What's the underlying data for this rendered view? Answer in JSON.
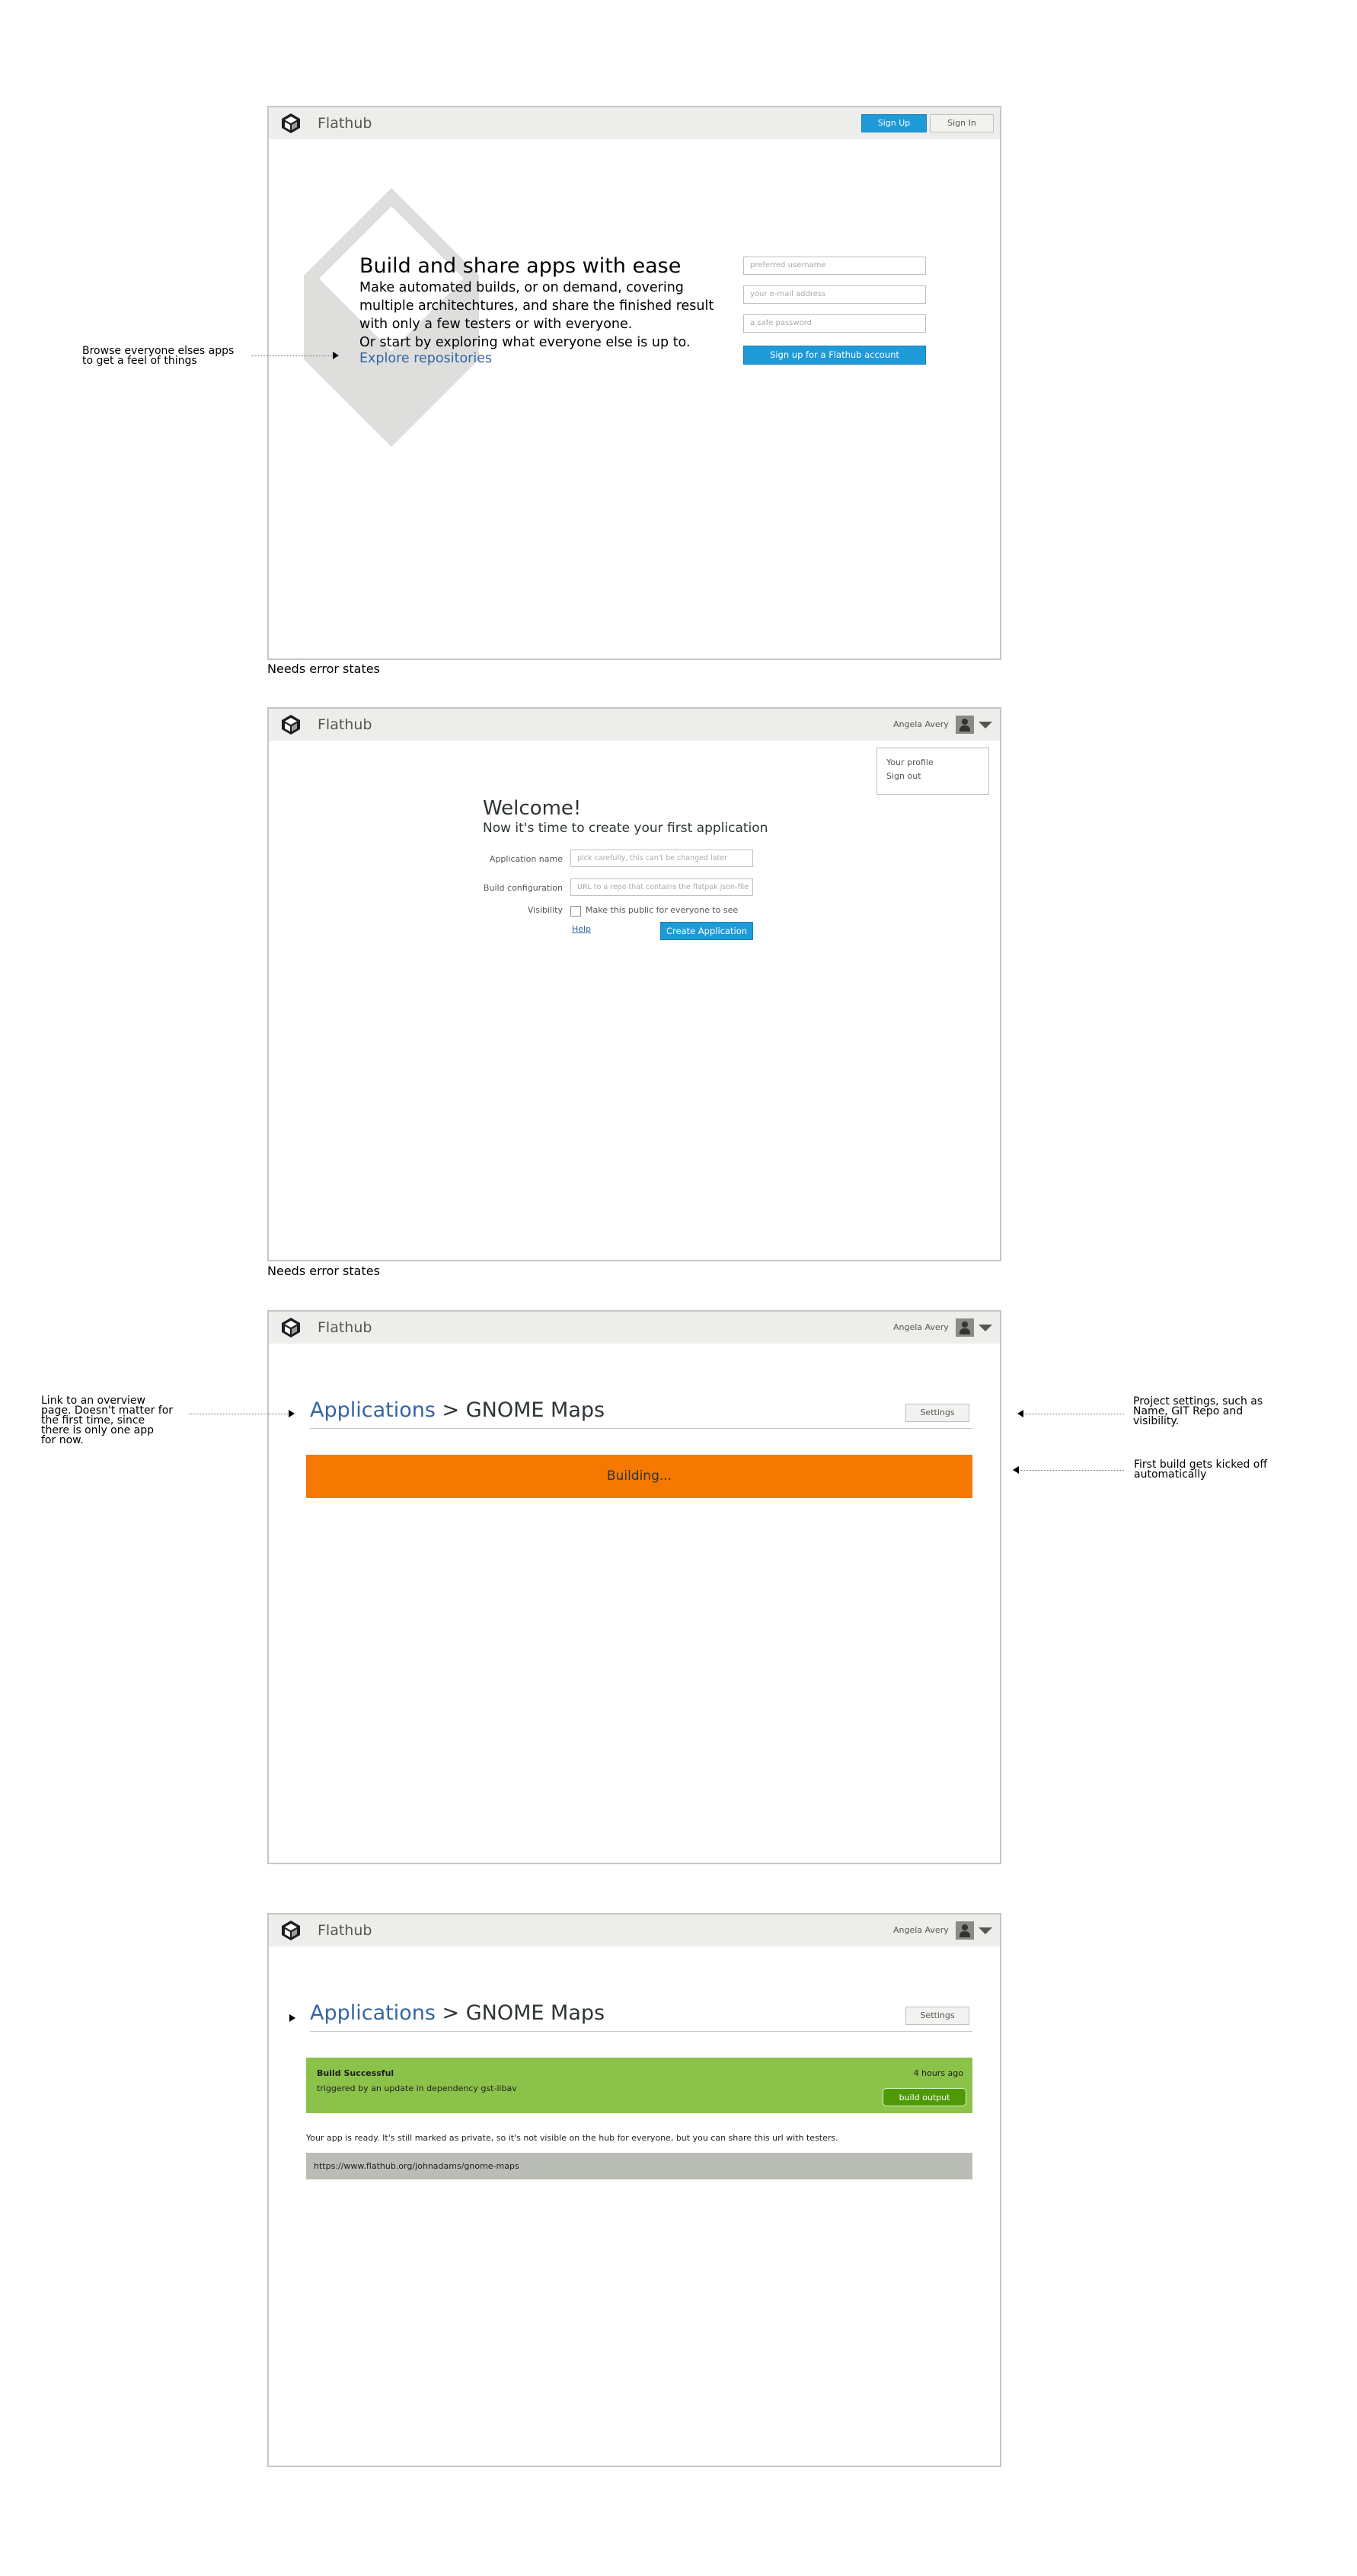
{
  "brand": "Flathub",
  "colors": {
    "accent_blue": "#1f9ad8",
    "link_blue": "#3465a4",
    "building_orange": "#f57900",
    "success_green": "#8bc34a",
    "header_grey": "#ededeb"
  },
  "screen1": {
    "sign_up": "Sign Up",
    "sign_in": "Sign In",
    "headline": "Build and share apps with ease",
    "body_lines": [
      "Make automated builds, or on demand, covering",
      "multiple architechtures, and share the finished result",
      "with only a few testers or with everyone.",
      "Or start by exploring what everyone else is up to."
    ],
    "explore_link": "Explore repositories",
    "username_placeholder": "preferred username",
    "email_placeholder": "your e-mail address",
    "password_placeholder": "a safe password",
    "signup_button": "Sign up for a Flathub account",
    "note_lines": [
      "Browse everyone elses apps",
      "to get a feel of things"
    ],
    "footer_note": "Needs error states"
  },
  "screen2": {
    "user_name": "Angela Avery",
    "menu": [
      "Your profile",
      "Sign out"
    ],
    "title": "Welcome!",
    "subtitle": "Now it's time to create your first application",
    "app_name_label": "Application name",
    "app_name_placeholder": "pick carefully, this can't be changed later",
    "build_config_label": "Build configuration",
    "build_config_placeholder": "URL to a repo that contains the flatpak json-file",
    "visibility_label": "Visibility",
    "visibility_checkbox": "Make this public for everyone to see",
    "help_link": "Help",
    "create_button": "Create Application",
    "footer_note": "Needs error states"
  },
  "screen3": {
    "user_name": "Angela Avery",
    "crumb_link": "Applications",
    "crumb_rest": " > GNOME Maps",
    "settings": "Settings",
    "building": "Building...",
    "note_left": [
      "Link to an overview",
      "page. Doesn't matter for",
      "the first time, since",
      "there is only one app",
      "for now."
    ],
    "note_right1": [
      "Project settings, such as",
      "Name, GIT Repo and",
      "visibility."
    ],
    "note_right2": [
      "First build gets kicked off",
      "automatically"
    ]
  },
  "screen4": {
    "user_name": "Angela Avery",
    "crumb_link": "Applications",
    "crumb_rest": " > GNOME Maps",
    "settings": "Settings",
    "build_status": "Build Successful",
    "build_trigger": "triggered by an update in dependency gst-libav",
    "build_time": "4 hours ago",
    "build_output": "build output",
    "ready_text": "Your app is ready. It's still marked as private, so it's not visible on the hub for everyone, but you can share this url with testers.",
    "share_url": "https://www.flathub.org/johnadams/gnome-maps"
  },
  "icons": [
    "flathub-logo-icon",
    "avatar-icon",
    "chevron-down-icon",
    "arrow-right-icon",
    "arrow-left-icon",
    "checkbox-icon"
  ]
}
